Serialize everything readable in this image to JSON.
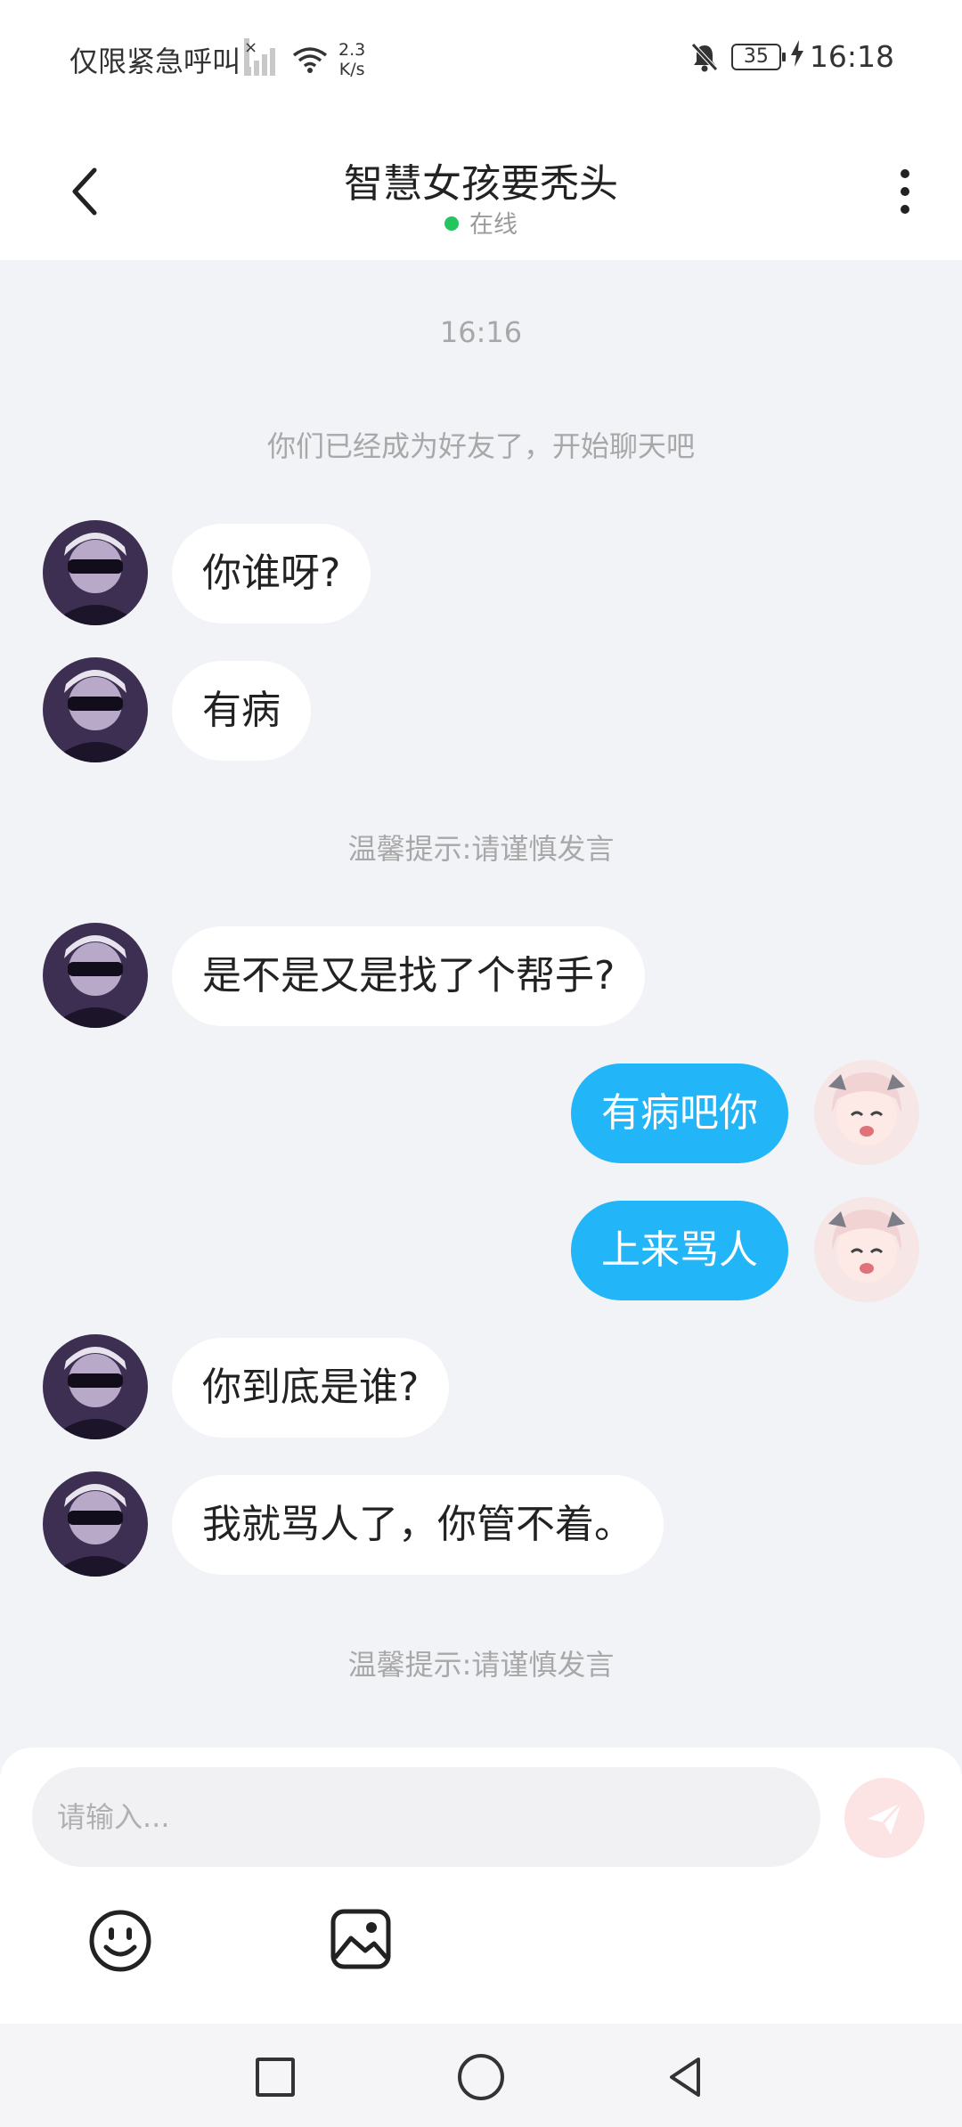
{
  "status_bar": {
    "carrier": "仅限紧急呼叫",
    "net_speed_value": "2.3",
    "net_speed_unit": "K/s",
    "battery": "35",
    "time": "16:18"
  },
  "header": {
    "title": "智慧女孩要秃头",
    "status": "在线"
  },
  "chat": {
    "timestamp": "16:16",
    "friend_notice": "你们已经成为好友了，开始聊天吧",
    "tip_1": "温馨提示:请谨慎发言",
    "tip_2": "温馨提示:请谨慎发言",
    "messages": [
      {
        "side": "in",
        "text": "你谁呀?"
      },
      {
        "side": "in",
        "text": "有病"
      },
      {
        "side": "in",
        "text": "是不是又是找了个帮手?"
      },
      {
        "side": "out",
        "text": "有病吧你"
      },
      {
        "side": "out",
        "text": "上来骂人"
      },
      {
        "side": "in",
        "text": "你到底是谁?"
      },
      {
        "side": "in",
        "text": "我就骂人了，你管不着。"
      }
    ]
  },
  "composer": {
    "placeholder": "请输入..."
  },
  "icons": {
    "back": "chevron-left-icon",
    "more": "more-vertical-icon",
    "send": "send-icon",
    "emoji": "emoji-icon",
    "image": "image-icon",
    "nav_recent": "square-icon",
    "nav_home": "circle-icon",
    "nav_back": "triangle-back-icon"
  },
  "colors": {
    "accent": "#22b5f7",
    "online": "#22c55e",
    "send_button": "#fde4e4"
  }
}
